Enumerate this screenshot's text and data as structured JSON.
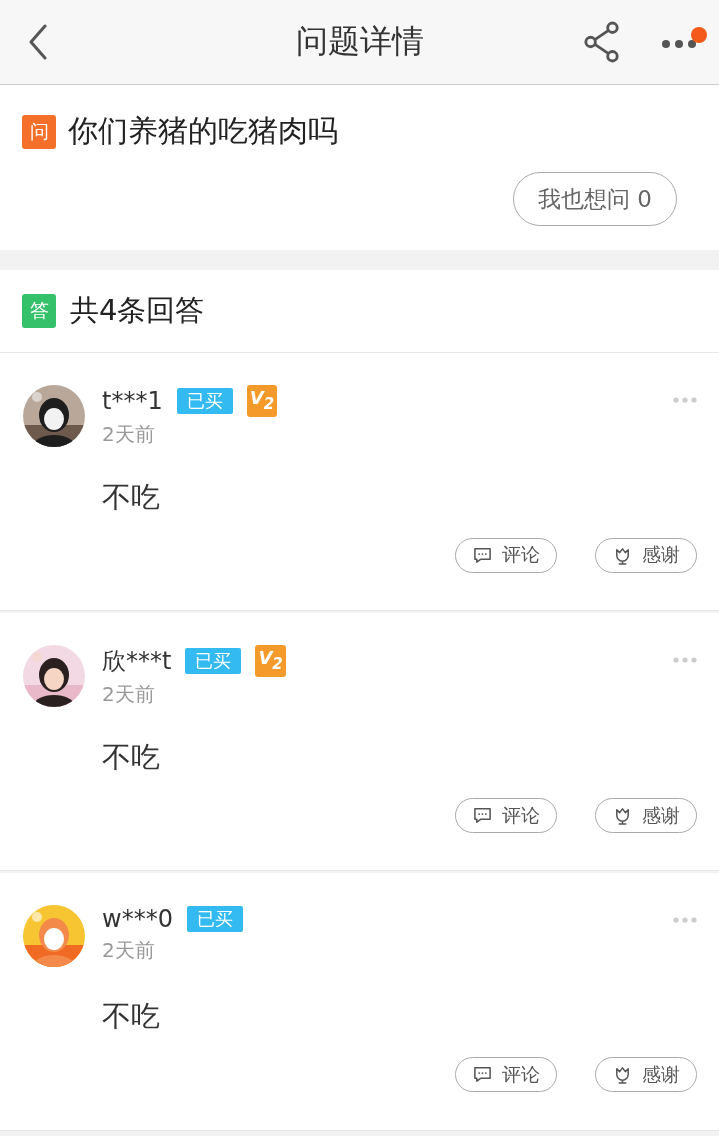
{
  "header": {
    "title": "问题详情",
    "notification_dot": true
  },
  "question": {
    "badge": "问",
    "text": "你们养猪的吃猪肉吗",
    "ask_button": "我也想问 0"
  },
  "answers_header": {
    "badge": "答",
    "title": "共4条回答"
  },
  "answers": [
    {
      "user": "t***1",
      "purchased_badge": "已买",
      "level_badge": "V$_{2}$",
      "time": "2天前",
      "text": "不吃",
      "comment_button": "评论",
      "thanks_button": "感谢"
    },
    {
      "user": "欣***t",
      "purchased_badge": "已买",
      "level_badge": "V$_{2}$",
      "time": "2天前",
      "text": "不吃",
      "comment_button": "评论",
      "thanks_button": "感谢"
    },
    {
      "user": "w***0",
      "purchased_badge": "已买",
      "time": "2天前",
      "text": "不吃",
      "comment_button": "评论",
      "thanks_button": "感谢"
    }
  ]
}
